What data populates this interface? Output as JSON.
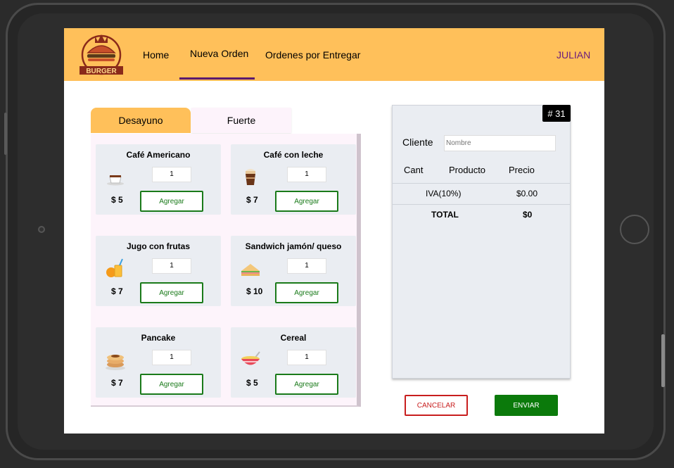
{
  "header": {
    "logo_text": "BURGER",
    "nav": [
      "Home",
      "Nueva Orden",
      "Ordenes por Entregar"
    ],
    "user": "JULIAN"
  },
  "tabs": [
    "Desayuno",
    "Fuerte"
  ],
  "menu": [
    {
      "name": "Café Americano",
      "icon": "coffee-cup-icon",
      "qty": "1",
      "price": "$ 5",
      "add_label": "Agregar"
    },
    {
      "name": "Café con leche",
      "icon": "latte-icon",
      "qty": "1",
      "price": "$ 7",
      "add_label": "Agregar"
    },
    {
      "name": "Jugo con frutas",
      "icon": "juice-icon",
      "qty": "1",
      "price": "$ 7",
      "add_label": "Agregar"
    },
    {
      "name": "Sandwich jamón/ queso",
      "icon": "sandwich-icon",
      "qty": "1",
      "price": "$ 10",
      "add_label": "Agregar"
    },
    {
      "name": "Pancake",
      "icon": "pancake-icon",
      "qty": "1",
      "price": "$ 7",
      "add_label": "Agregar"
    },
    {
      "name": "Cereal",
      "icon": "cereal-bowl-icon",
      "qty": "1",
      "price": "$ 5",
      "add_label": "Agregar"
    }
  ],
  "order": {
    "number": "# 31",
    "client_label": "Cliente",
    "client_placeholder": "Nombre",
    "columns": [
      "Cant",
      "Producto",
      "Precio"
    ],
    "iva_label": "IVA(10%)",
    "iva_value": "$0.00",
    "total_label": "TOTAL",
    "total_value": "$0"
  },
  "actions": {
    "cancel": "CANCELAR",
    "send": "ENVIAR"
  },
  "colors": {
    "header_bg": "#ffc05a",
    "accent_purple": "#6a1b7d",
    "green": "#0b7a0b",
    "red": "#c81e1e"
  }
}
